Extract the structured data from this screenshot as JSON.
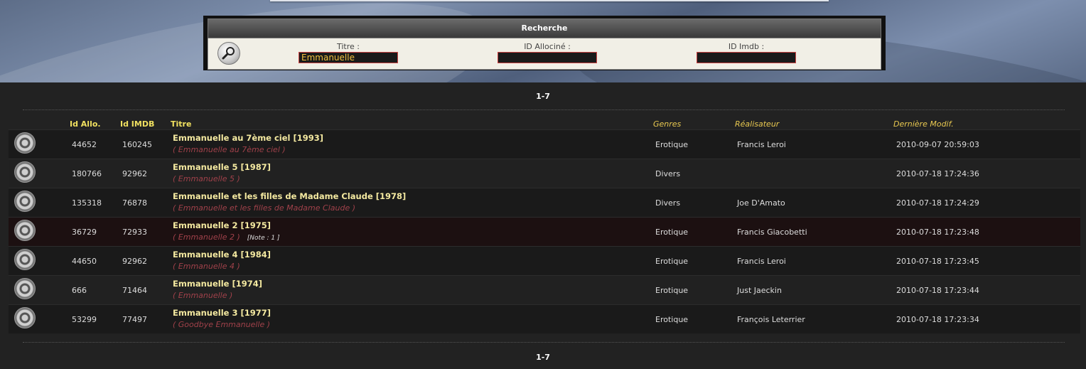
{
  "search": {
    "header": "Recherche",
    "titre_label": "Titre :",
    "titre_value": "Emmanuelle",
    "allocine_label": "ID Allociné :",
    "allocine_value": "",
    "imdb_label": "ID Imdb :",
    "imdb_value": ""
  },
  "paging": {
    "top": "1-7",
    "bottom": "1-7"
  },
  "columns": {
    "id_allo": "Id Allo.",
    "id_imdb": "Id IMDB",
    "titre": "Titre",
    "genres": "Genres",
    "realisateur": "Réalisateur",
    "modif": "Dernière Modif."
  },
  "rows": [
    {
      "id_allo": "44652",
      "id_imdb": "160245",
      "title": "Emmanuelle au 7ème ciel [1993]",
      "original": "( Emmanuelle au 7ème ciel )",
      "note": "",
      "genre": "Erotique",
      "director": "Francis Leroi",
      "modified": "2010-09-07 20:59:03"
    },
    {
      "id_allo": "180766",
      "id_imdb": "92962",
      "title": "Emmanuelle 5 [1987]",
      "original": "( Emmanuelle 5 )",
      "note": "",
      "genre": "Divers",
      "director": "",
      "modified": "2010-07-18 17:24:36"
    },
    {
      "id_allo": "135318",
      "id_imdb": "76878",
      "title": "Emmanuelle et les filles de Madame Claude [1978]",
      "original": "( Emmanuelle et les filles de Madame Claude )",
      "note": "",
      "genre": "Divers",
      "director": "Joe D'Amato",
      "modified": "2010-07-18 17:24:29"
    },
    {
      "id_allo": "36729",
      "id_imdb": "72933",
      "title": "Emmanuelle 2 [1975]",
      "original": "( Emmanuelle 2 )",
      "note": "[Note : 1 ]",
      "genre": "Erotique",
      "director": "Francis Giacobetti",
      "modified": "2010-07-18 17:23:48"
    },
    {
      "id_allo": "44650",
      "id_imdb": "92962",
      "title": "Emmanuelle 4 [1984]",
      "original": "( Emmanuelle 4 )",
      "note": "",
      "genre": "Erotique",
      "director": "Francis Leroi",
      "modified": "2010-07-18 17:23:45"
    },
    {
      "id_allo": "666",
      "id_imdb": "71464",
      "title": "Emmanuelle [1974]",
      "original": "( Emmanuelle )",
      "note": "",
      "genre": "Erotique",
      "director": "Just Jaeckin",
      "modified": "2010-07-18 17:23:44"
    },
    {
      "id_allo": "53299",
      "id_imdb": "77497",
      "title": "Emmanuelle 3 [1977]",
      "original": "( Goodbye Emmanuelle )",
      "note": "",
      "genre": "Erotique",
      "director": "François Leterrier",
      "modified": "2010-07-18 17:23:34"
    }
  ]
}
